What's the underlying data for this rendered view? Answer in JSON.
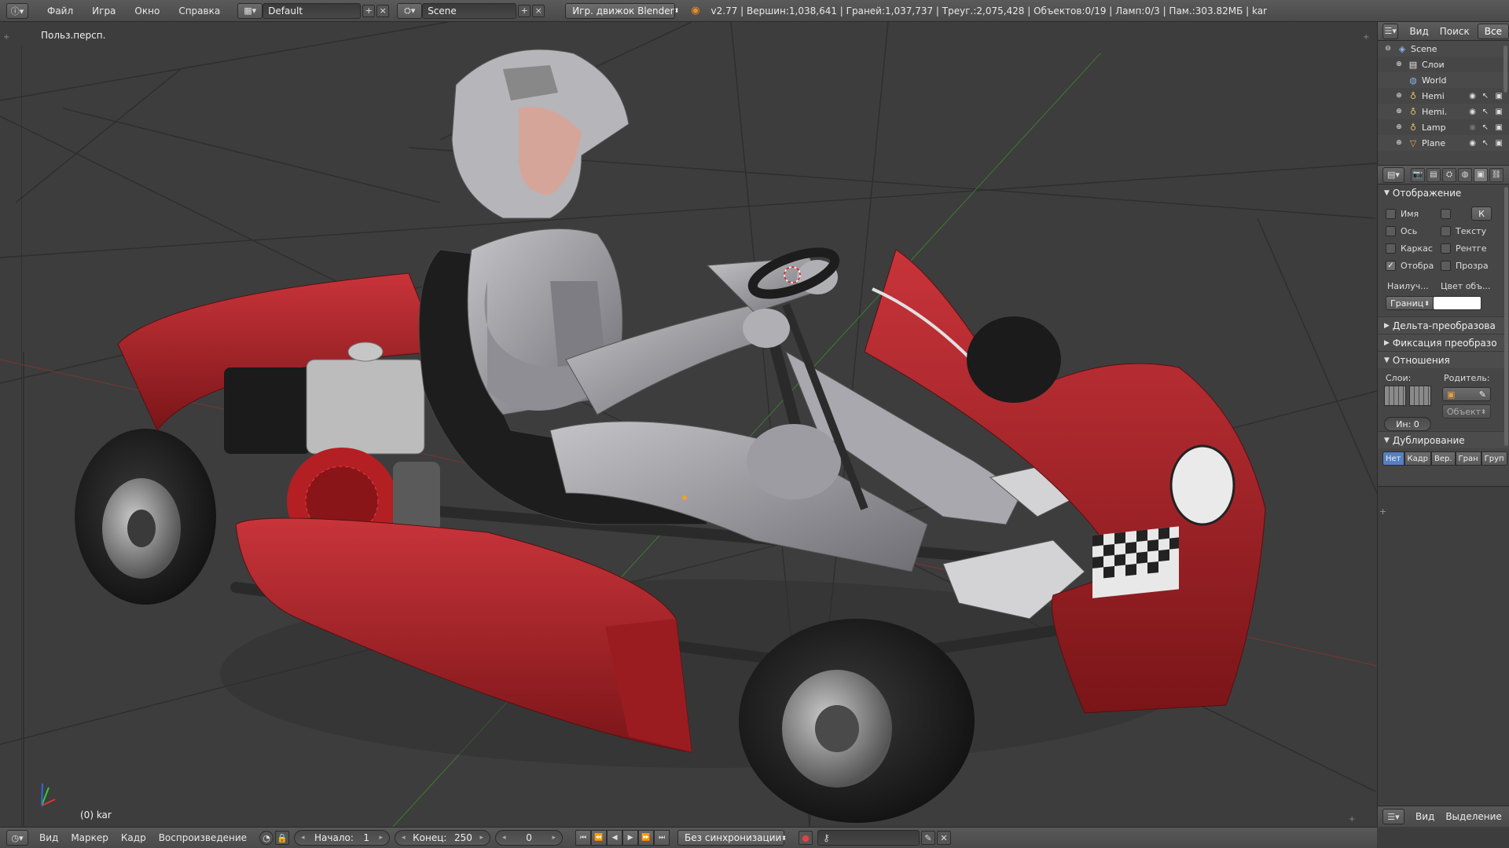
{
  "topbar": {
    "menu": [
      "Файл",
      "Игра",
      "Окно",
      "Справка"
    ],
    "layout": "Default",
    "scene": "Scene",
    "engine": "Игр. движок Blender",
    "stats": "v2.77 | Вершин:1,038,641 | Граней:1,037,737 | Треуг.:2,075,428 | Объектов:0/19 | Ламп:0/3 | Пам.:303.82МБ | kar"
  },
  "viewport": {
    "view_label": "Польз.персп.",
    "object_label": "(0) kar",
    "axes": {
      "x": "x",
      "y": "y",
      "z": "z"
    }
  },
  "timeline": {
    "menu": [
      "Вид",
      "Маркер",
      "Кадр",
      "Воспроизведение"
    ],
    "start_label": "Начало:",
    "start_value": "1",
    "end_label": "Конец:",
    "end_value": "250",
    "current_frame": "0",
    "sync": "Без синхронизации"
  },
  "outliner": {
    "menu": [
      "Вид",
      "Поиск"
    ],
    "filter": "Все",
    "rows": [
      {
        "label": "Scene",
        "icon": "scene-icon"
      },
      {
        "label": "Слои",
        "icon": "layers-icon"
      },
      {
        "label": "World",
        "icon": "world-icon"
      },
      {
        "label": "Hemi",
        "icon": "lamp-icon"
      },
      {
        "label": "Hemi.",
        "icon": "lamp-icon"
      },
      {
        "label": "Lamp",
        "icon": "lamp-icon"
      },
      {
        "label": "Plane",
        "icon": "mesh-icon"
      }
    ]
  },
  "properties": {
    "display_panel": "Отображение",
    "checks": {
      "name": "Имя",
      "axis": "Ось",
      "wire": "Каркас",
      "display": "Отобра",
      "texture": "Тексту",
      "xray": "Рентге",
      "transp": "Прозра"
    },
    "k_field": "К",
    "best_label": "Наилуч...",
    "color_label": "Цвет объ...",
    "bounds": "Границ",
    "delta_panel": "Дельта-преобразова",
    "lock_panel": "Фиксация преобразо",
    "relations_panel": "Отношения",
    "layers_label": "Слои:",
    "parent_label": "Родитель:",
    "object_dd": "Объект",
    "index": "Ин: 0",
    "dupli_panel": "Дублирование",
    "dupli_tabs": [
      "Нет",
      "Кадр",
      "Вер.",
      "Гран",
      "Груп"
    ]
  },
  "bottom_right": {
    "menu": [
      "Вид",
      "Выделение"
    ]
  },
  "colors": {
    "kart_red": "#b3262a",
    "suit_grey": "#9a9a9e",
    "viewport_bg": "#3d3d3d",
    "grid_x": "#8a3a3a",
    "grid_y": "#4a7a3a"
  }
}
